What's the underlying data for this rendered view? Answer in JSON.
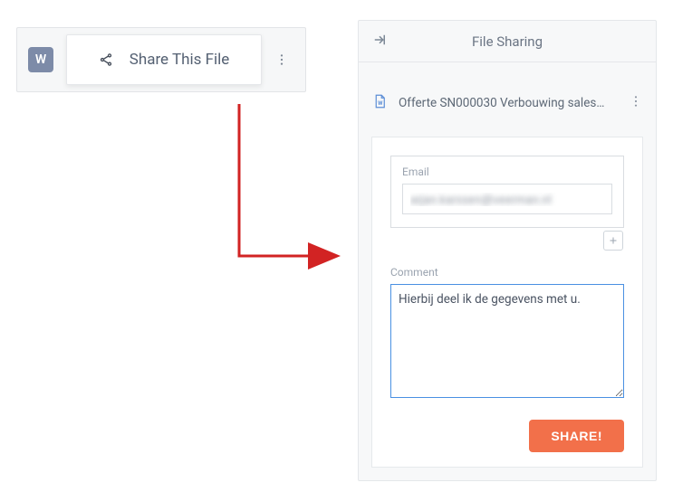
{
  "left_widget": {
    "badge": "W",
    "share_label": "Share This File"
  },
  "arrow": {
    "color": "#d22323"
  },
  "panel": {
    "title": "File Sharing",
    "file_name": "Offerte SN000030 Verbouwing sales…",
    "email_label": "Email",
    "email_value": "arjan.karssen@veerman.nl",
    "comment_label": "Comment",
    "comment_value": "Hierbij deel ik de gegevens met u.",
    "share_button": "SHARE!"
  }
}
